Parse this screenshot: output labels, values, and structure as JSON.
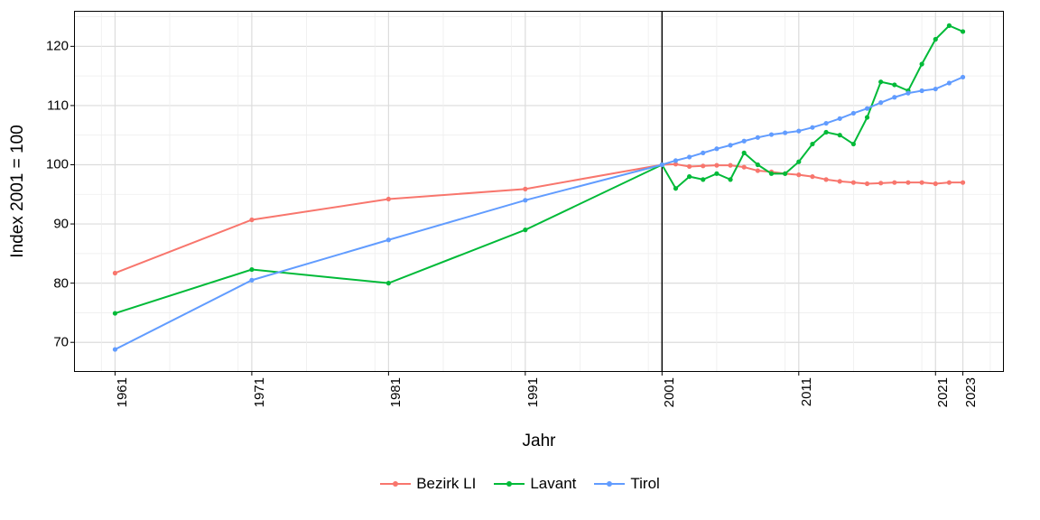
{
  "chart_data": {
    "type": "line",
    "xlabel": "Jahr",
    "ylabel": "Index 2001 = 100",
    "x_ticks": [
      1961,
      1971,
      1981,
      1991,
      2001,
      2011,
      2021,
      2023
    ],
    "y_ticks": [
      70,
      80,
      90,
      100,
      110,
      120
    ],
    "xlim": [
      1958,
      2026
    ],
    "ylim": [
      65,
      126
    ],
    "vline": 2001,
    "colors": {
      "Bezirk LI": "#f8766d",
      "Lavant": "#00ba38",
      "Tirol": "#619cff"
    },
    "series": [
      {
        "name": "Bezirk LI",
        "x": [
          1961,
          1971,
          1981,
          1991,
          2001,
          2002,
          2003,
          2004,
          2005,
          2006,
          2007,
          2008,
          2009,
          2010,
          2011,
          2012,
          2013,
          2014,
          2015,
          2016,
          2017,
          2018,
          2019,
          2020,
          2021,
          2022,
          2023
        ],
        "values": [
          81.7,
          90.7,
          94.2,
          95.9,
          100.0,
          100.1,
          99.7,
          99.8,
          99.9,
          99.9,
          99.6,
          99.0,
          98.8,
          98.5,
          98.3,
          98.0,
          97.5,
          97.2,
          97.0,
          96.8,
          96.9,
          97.0,
          97.0,
          97.0,
          96.8,
          97.0,
          97.0
        ]
      },
      {
        "name": "Lavant",
        "x": [
          1961,
          1971,
          1981,
          1991,
          2001,
          2002,
          2003,
          2004,
          2005,
          2006,
          2007,
          2008,
          2009,
          2010,
          2011,
          2012,
          2013,
          2014,
          2015,
          2016,
          2017,
          2018,
          2019,
          2020,
          2021,
          2022,
          2023
        ],
        "values": [
          74.9,
          82.3,
          80.0,
          89.0,
          100.0,
          96.0,
          98.0,
          97.5,
          98.5,
          97.5,
          102.0,
          100.0,
          98.5,
          98.5,
          100.5,
          103.5,
          105.5,
          105.0,
          103.5,
          108.0,
          114.0,
          113.5,
          112.5,
          117.0,
          121.2,
          123.5,
          122.5
        ]
      },
      {
        "name": "Tirol",
        "x": [
          1961,
          1971,
          1981,
          1991,
          2001,
          2002,
          2003,
          2004,
          2005,
          2006,
          2007,
          2008,
          2009,
          2010,
          2011,
          2012,
          2013,
          2014,
          2015,
          2016,
          2017,
          2018,
          2019,
          2020,
          2021,
          2022,
          2023
        ],
        "values": [
          68.8,
          80.5,
          87.3,
          94.0,
          100.0,
          100.7,
          101.3,
          102.0,
          102.7,
          103.3,
          104.0,
          104.6,
          105.1,
          105.4,
          105.7,
          106.3,
          107.0,
          107.8,
          108.7,
          109.5,
          110.5,
          111.4,
          112.1,
          112.5,
          112.8,
          113.8,
          114.8
        ]
      }
    ]
  }
}
